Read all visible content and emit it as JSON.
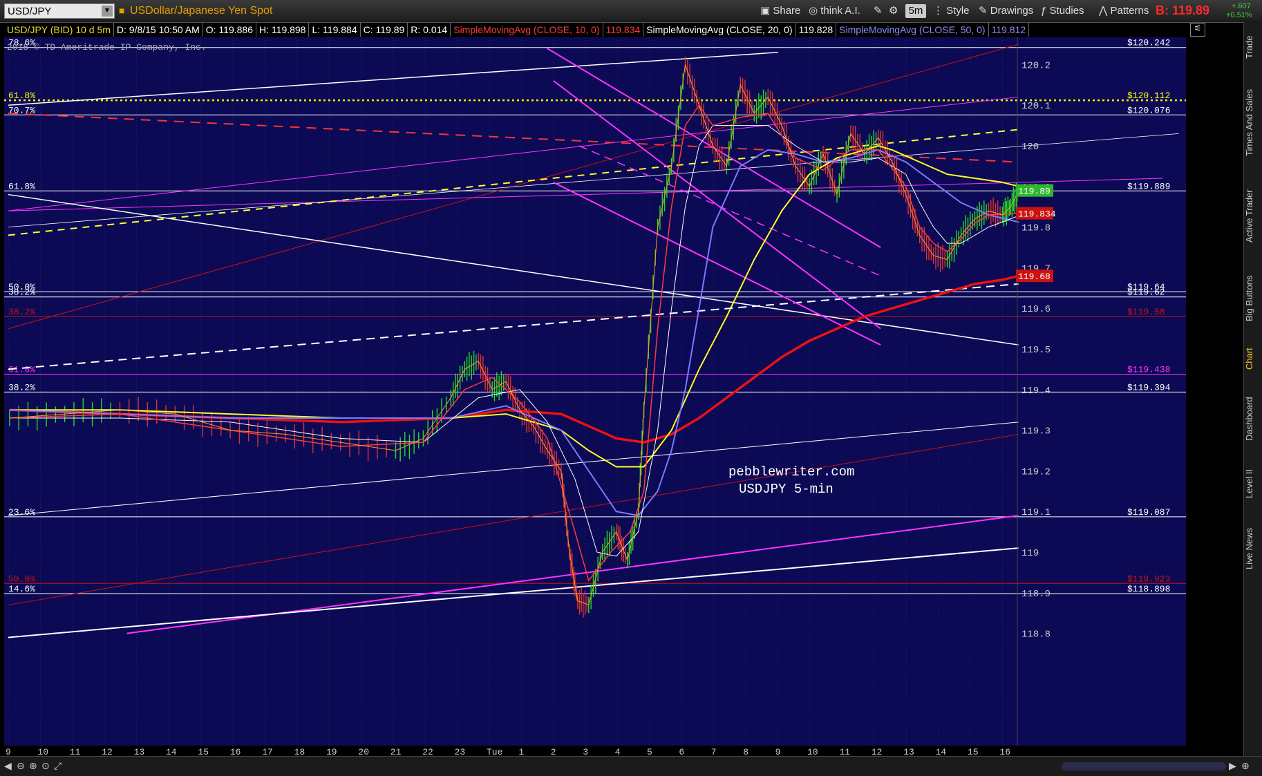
{
  "toolbar": {
    "symbol": "USD/JPY",
    "description": "USDollar/Japanese Yen Spot",
    "share": "Share",
    "think_ai": "think A.I.",
    "interval": "5m",
    "style": "Style",
    "drawings": "Drawings",
    "studies": "Studies",
    "patterns": "Patterns",
    "bid_price": "B: 119.89",
    "change_abs": "+.607",
    "change_pct": "+0.51%"
  },
  "infobar": {
    "symbol": "USD/JPY (BID) 10 d 5m",
    "date": "D: 9/8/15 10:50 AM",
    "open": "O: 119.886",
    "high": "H: 119.898",
    "low": "L: 119.884",
    "close": "C: 119.89",
    "range": "R: 0.014",
    "sma10": "SimpleMovingAvg (CLOSE, 10, 0)",
    "sma10_val": "119.834",
    "sma20": "SimpleMovingAvg (CLOSE, 20, 0)",
    "sma20_val": "119.828",
    "sma50": "SimpleMovingAvg (CLOSE, 50, 0)",
    "sma50_val": "119.812"
  },
  "copyright": "2015 © TD Ameritrade IP Company, Inc.",
  "watermark": [
    "pebblewriter.com",
    "USDJPY 5-min"
  ],
  "side_tabs": [
    "Trade",
    "Times And Sales",
    "Active Trader",
    "Big Buttons",
    "Chart",
    "Dashboard",
    "Level II",
    "Live News"
  ],
  "chart_data": {
    "type": "line",
    "title": "",
    "y_axis_ticks": [
      "120.2",
      "120.1",
      "120",
      "119.9",
      "119.8",
      "119.7",
      "119.6",
      "119.5",
      "119.4",
      "119.3",
      "119.2",
      "119.1",
      "119",
      "118.9",
      "118.8"
    ],
    "ylim": [
      118.79,
      120.28
    ],
    "x_axis_ticks": [
      "9",
      "10",
      "11",
      "12",
      "13",
      "14",
      "15",
      "16",
      "17",
      "18",
      "19",
      "20",
      "21",
      "22",
      "23",
      "Tue",
      "1",
      "2",
      "3",
      "4",
      "5",
      "6",
      "7",
      "8",
      "9",
      "10",
      "11",
      "12",
      "13",
      "14",
      "15",
      "16"
    ],
    "price_tags": [
      {
        "value": 119.89,
        "label": "119.89",
        "color": "#2eb82e"
      },
      {
        "value": 119.834,
        "label": "119.834",
        "color": "#cc1111"
      },
      {
        "value": 119.68,
        "label": "119.68",
        "color": "#cc1111"
      }
    ],
    "fib_levels": [
      {
        "label": "78.6%",
        "value_label": "$120.242",
        "value": 120.242,
        "color": "#ffffff",
        "dash": "solid"
      },
      {
        "label": "61.8%",
        "value_label": "$120.112",
        "value": 120.112,
        "color": "#ffff00",
        "dash": "dot"
      },
      {
        "label": "70.7%",
        "value_label": "$120.076",
        "value": 120.076,
        "color": "#ffffff",
        "dash": "solid"
      },
      {
        "label": "61.8%",
        "value_label": "$119.889",
        "value": 119.889,
        "color": "#ffffff",
        "dash": "solid"
      },
      {
        "label": "50.0%",
        "value_label": "$119.64",
        "value": 119.641,
        "color": "#ffffff",
        "dash": "solid"
      },
      {
        "label": "38.2%",
        "value_label": "$119.62",
        "value": 119.628,
        "color": "#ffffff",
        "dash": "solid"
      },
      {
        "label": "38.2%",
        "value_label": "$119.58",
        "value": 119.58,
        "color": "#cc1111",
        "dash": "solid"
      },
      {
        "label": "61.8%",
        "value_label": "$119.438",
        "value": 119.438,
        "color": "#ff33ff",
        "dash": "solid"
      },
      {
        "label": "38.2%",
        "value_label": "$119.394",
        "value": 119.394,
        "color": "#ffffff",
        "dash": "solid"
      },
      {
        "label": "23.6%",
        "value_label": "$119.087",
        "value": 119.087,
        "color": "#ffffff",
        "dash": "solid"
      },
      {
        "label": "50.0%",
        "value_label": "$118.923",
        "value": 118.923,
        "color": "#cc1111",
        "dash": "solid"
      },
      {
        "label": "14.6%",
        "value_label": "$118.898",
        "value": 118.898,
        "color": "#ffffff",
        "dash": "solid"
      }
    ],
    "series": [
      {
        "name": "USD/JPY 5m",
        "color": "#22cc22"
      },
      {
        "name": "SimpleMovingAvg (CLOSE, 10, 0)",
        "color": "#ff3a3a"
      },
      {
        "name": "SimpleMovingAvg (CLOSE, 20, 0)",
        "color": "#ffffff"
      },
      {
        "name": "SimpleMovingAvg (CLOSE, 50, 0)",
        "color": "#7a7aff"
      }
    ],
    "price_path": [
      [
        0,
        119.33
      ],
      [
        2,
        119.34
      ],
      [
        4,
        119.35
      ],
      [
        6,
        119.34
      ],
      [
        8,
        119.3
      ],
      [
        10,
        119.29
      ],
      [
        12,
        119.27
      ],
      [
        14,
        119.25
      ],
      [
        15,
        119.28
      ],
      [
        16,
        119.38
      ],
      [
        16.5,
        119.45
      ],
      [
        17,
        119.47
      ],
      [
        17.5,
        119.4
      ],
      [
        18,
        119.42
      ],
      [
        18.5,
        119.35
      ],
      [
        19,
        119.31
      ],
      [
        19.5,
        119.25
      ],
      [
        20,
        119.2
      ],
      [
        20.3,
        119.0
      ],
      [
        20.6,
        118.88
      ],
      [
        21,
        118.87
      ],
      [
        21.5,
        119.0
      ],
      [
        22,
        119.05
      ],
      [
        22.4,
        118.98
      ],
      [
        22.8,
        119.1
      ],
      [
        23,
        119.35
      ],
      [
        23.5,
        119.8
      ],
      [
        24,
        119.95
      ],
      [
        24.5,
        120.2
      ],
      [
        25,
        120.1
      ],
      [
        25.5,
        120.0
      ],
      [
        26,
        119.95
      ],
      [
        26.5,
        120.15
      ],
      [
        27,
        120.08
      ],
      [
        27.5,
        120.12
      ],
      [
        28,
        120.05
      ],
      [
        28.5,
        119.95
      ],
      [
        29,
        119.9
      ],
      [
        29.5,
        119.98
      ],
      [
        30,
        119.88
      ],
      [
        30.5,
        120.03
      ],
      [
        31,
        119.98
      ],
      [
        31.5,
        120.02
      ],
      [
        32,
        119.96
      ],
      [
        32.5,
        119.88
      ],
      [
        33,
        119.78
      ],
      [
        33.5,
        119.73
      ],
      [
        34,
        119.72
      ],
      [
        34.5,
        119.78
      ],
      [
        35,
        119.82
      ],
      [
        35.5,
        119.84
      ],
      [
        36,
        119.83
      ],
      [
        36.3,
        119.85
      ],
      [
        36.6,
        119.89
      ]
    ],
    "sma10_path": [
      [
        0,
        119.33
      ],
      [
        4,
        119.34
      ],
      [
        8,
        119.3
      ],
      [
        12,
        119.26
      ],
      [
        15,
        119.27
      ],
      [
        16.5,
        119.4
      ],
      [
        17.5,
        119.43
      ],
      [
        18.5,
        119.37
      ],
      [
        19.5,
        119.28
      ],
      [
        20.5,
        119.05
      ],
      [
        21,
        118.93
      ],
      [
        21.8,
        119.0
      ],
      [
        22.5,
        119.05
      ],
      [
        23,
        119.15
      ],
      [
        23.5,
        119.55
      ],
      [
        24,
        119.85
      ],
      [
        24.5,
        120.05
      ],
      [
        25,
        120.1
      ],
      [
        25.5,
        120.05
      ],
      [
        26.5,
        120.07
      ],
      [
        27.5,
        120.08
      ],
      [
        28.5,
        119.97
      ],
      [
        29.5,
        119.94
      ],
      [
        30.5,
        119.99
      ],
      [
        31.5,
        119.99
      ],
      [
        32.5,
        119.9
      ],
      [
        33,
        119.8
      ],
      [
        33.5,
        119.76
      ],
      [
        34,
        119.74
      ],
      [
        34.5,
        119.77
      ],
      [
        35,
        119.81
      ],
      [
        35.5,
        119.83
      ],
      [
        36.6,
        119.834
      ]
    ],
    "sma20_path": [
      [
        0,
        119.33
      ],
      [
        4,
        119.33
      ],
      [
        8,
        119.32
      ],
      [
        12,
        119.28
      ],
      [
        15,
        119.27
      ],
      [
        17,
        119.38
      ],
      [
        18.5,
        119.4
      ],
      [
        19.5,
        119.32
      ],
      [
        20.5,
        119.18
      ],
      [
        21.3,
        119.0
      ],
      [
        22,
        118.99
      ],
      [
        22.8,
        119.05
      ],
      [
        23.5,
        119.3
      ],
      [
        24,
        119.6
      ],
      [
        24.5,
        119.85
      ],
      [
        25,
        120.0
      ],
      [
        25.5,
        120.05
      ],
      [
        26.5,
        120.05
      ],
      [
        27.5,
        120.05
      ],
      [
        28.5,
        120.0
      ],
      [
        29.5,
        119.96
      ],
      [
        30.5,
        119.96
      ],
      [
        31.5,
        119.97
      ],
      [
        32.5,
        119.93
      ],
      [
        33,
        119.86
      ],
      [
        33.5,
        119.8
      ],
      [
        34,
        119.76
      ],
      [
        34.5,
        119.76
      ],
      [
        35,
        119.78
      ],
      [
        35.5,
        119.8
      ],
      [
        36.6,
        119.828
      ]
    ],
    "sma50_path": [
      [
        0,
        119.35
      ],
      [
        4,
        119.34
      ],
      [
        8,
        119.33
      ],
      [
        12,
        119.33
      ],
      [
        16,
        119.33
      ],
      [
        18,
        119.36
      ],
      [
        20,
        119.3
      ],
      [
        21,
        119.2
      ],
      [
        22,
        119.1
      ],
      [
        22.8,
        119.09
      ],
      [
        23.5,
        119.15
      ],
      [
        24,
        119.25
      ],
      [
        24.5,
        119.4
      ],
      [
        25,
        119.6
      ],
      [
        25.5,
        119.8
      ],
      [
        26.5,
        119.95
      ],
      [
        27.5,
        119.99
      ],
      [
        28.5,
        119.98
      ],
      [
        29.5,
        119.96
      ],
      [
        30.5,
        119.97
      ],
      [
        31.5,
        119.99
      ],
      [
        32.5,
        119.96
      ],
      [
        33.5,
        119.91
      ],
      [
        34.5,
        119.86
      ],
      [
        35.5,
        119.83
      ],
      [
        36.6,
        119.812
      ]
    ],
    "yellow_ma_path": [
      [
        0,
        119.35
      ],
      [
        4,
        119.35
      ],
      [
        8,
        119.34
      ],
      [
        12,
        119.33
      ],
      [
        16,
        119.33
      ],
      [
        18,
        119.34
      ],
      [
        20,
        119.3
      ],
      [
        21,
        119.25
      ],
      [
        22,
        119.21
      ],
      [
        23,
        119.21
      ],
      [
        24,
        119.3
      ],
      [
        25,
        119.45
      ],
      [
        26,
        119.58
      ],
      [
        27,
        119.72
      ],
      [
        28,
        119.84
      ],
      [
        29,
        119.93
      ],
      [
        30,
        119.97
      ],
      [
        31,
        119.99
      ],
      [
        31.5,
        120.0
      ],
      [
        32,
        119.99
      ],
      [
        33,
        119.96
      ],
      [
        34,
        119.93
      ],
      [
        35,
        119.92
      ],
      [
        36,
        119.91
      ],
      [
        36.6,
        119.9
      ]
    ],
    "red_ma_path": [
      [
        0,
        119.35
      ],
      [
        4,
        119.34
      ],
      [
        8,
        119.33
      ],
      [
        12,
        119.32
      ],
      [
        16,
        119.33
      ],
      [
        18,
        119.35
      ],
      [
        20,
        119.34
      ],
      [
        21,
        119.31
      ],
      [
        22,
        119.28
      ],
      [
        23,
        119.27
      ],
      [
        24,
        119.29
      ],
      [
        25,
        119.33
      ],
      [
        26,
        119.38
      ],
      [
        27,
        119.43
      ],
      [
        28,
        119.48
      ],
      [
        29,
        119.52
      ],
      [
        30,
        119.55
      ],
      [
        31,
        119.58
      ],
      [
        32,
        119.6
      ],
      [
        33,
        119.62
      ],
      [
        34,
        119.64
      ],
      [
        35,
        119.66
      ],
      [
        36,
        119.67
      ],
      [
        36.6,
        119.68
      ]
    ]
  }
}
